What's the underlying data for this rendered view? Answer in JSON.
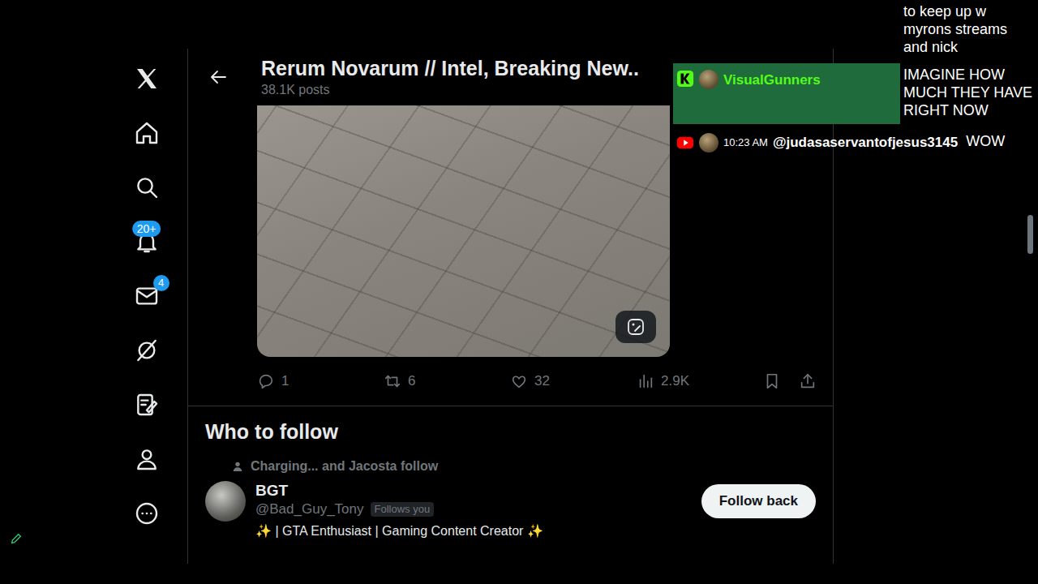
{
  "sidebar": {
    "notifications_badge": "20+",
    "messages_badge": "4"
  },
  "header": {
    "title": "Rerum Novarum // Intel, Breaking New..",
    "posts": "38.1K posts"
  },
  "post": {
    "replies": "1",
    "reposts": "6",
    "likes": "32",
    "views": "2.9K"
  },
  "who_to_follow": {
    "title": "Who to follow",
    "suggestions": [
      {
        "social_context": "Charging... and Jacosta follow",
        "name": "BGT",
        "handle": "@Bad_Guy_Tony",
        "follows_you": "Follows you",
        "bio": "✨ | GTA Enthusiast | Gaming Content Creator ✨",
        "button": "Follow back"
      }
    ]
  },
  "chat": {
    "messages": [
      {
        "kind": "continued",
        "text": "to keep up w myrons streams and nick"
      },
      {
        "kind": "highlight",
        "platform": "kick",
        "author": "VisualGunners",
        "text": "IMAGINE HOW MUCH THEY HAVE RIGHT NOW"
      },
      {
        "kind": "normal",
        "platform": "youtube",
        "time": "10:23 AM",
        "author": "@judasaservantofjesus3145",
        "text": "WOW"
      }
    ]
  }
}
